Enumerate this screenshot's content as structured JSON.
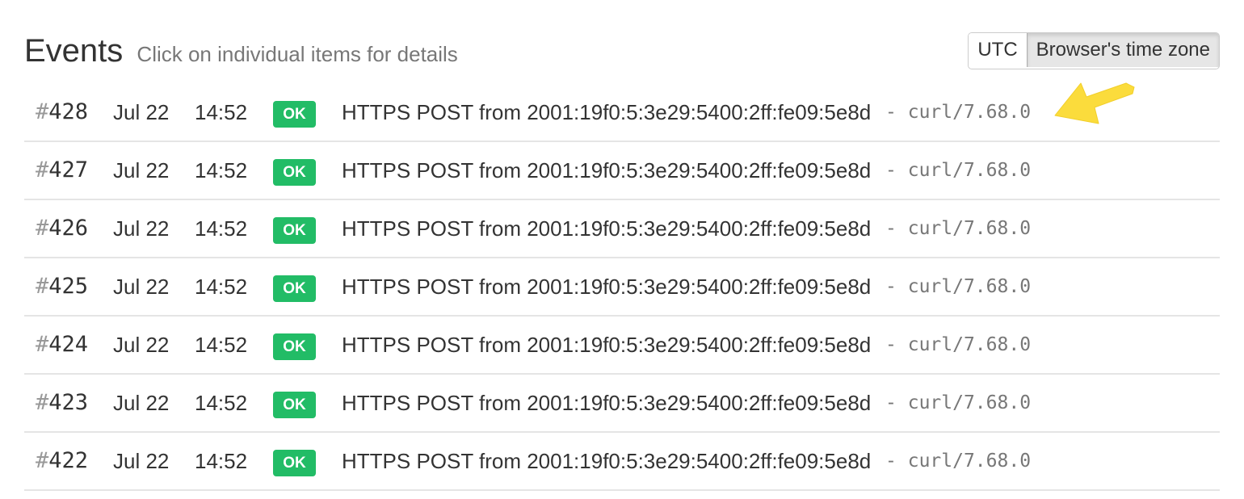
{
  "header": {
    "title": "Events",
    "subtitle": "Click on individual items for details",
    "timezone_options": [
      "UTC",
      "Browser's time zone"
    ],
    "timezone_selected": "Browser's time zone"
  },
  "status_color": "#22bc66",
  "annotation_arrow_color": "#fbdc3c",
  "events": [
    {
      "hash": "#",
      "number": "428",
      "date": "Jul 22",
      "time": "14:52",
      "status": "OK",
      "description": "HTTPS POST from 2001:19f0:5:3e29:5400:2ff:fe09:5e8d",
      "separator": "-",
      "user_agent": "curl/7.68.0"
    },
    {
      "hash": "#",
      "number": "427",
      "date": "Jul 22",
      "time": "14:52",
      "status": "OK",
      "description": "HTTPS POST from 2001:19f0:5:3e29:5400:2ff:fe09:5e8d",
      "separator": "-",
      "user_agent": "curl/7.68.0"
    },
    {
      "hash": "#",
      "number": "426",
      "date": "Jul 22",
      "time": "14:52",
      "status": "OK",
      "description": "HTTPS POST from 2001:19f0:5:3e29:5400:2ff:fe09:5e8d",
      "separator": "-",
      "user_agent": "curl/7.68.0"
    },
    {
      "hash": "#",
      "number": "425",
      "date": "Jul 22",
      "time": "14:52",
      "status": "OK",
      "description": "HTTPS POST from 2001:19f0:5:3e29:5400:2ff:fe09:5e8d",
      "separator": "-",
      "user_agent": "curl/7.68.0"
    },
    {
      "hash": "#",
      "number": "424",
      "date": "Jul 22",
      "time": "14:52",
      "status": "OK",
      "description": "HTTPS POST from 2001:19f0:5:3e29:5400:2ff:fe09:5e8d",
      "separator": "-",
      "user_agent": "curl/7.68.0"
    },
    {
      "hash": "#",
      "number": "423",
      "date": "Jul 22",
      "time": "14:52",
      "status": "OK",
      "description": "HTTPS POST from 2001:19f0:5:3e29:5400:2ff:fe09:5e8d",
      "separator": "-",
      "user_agent": "curl/7.68.0"
    },
    {
      "hash": "#",
      "number": "422",
      "date": "Jul 22",
      "time": "14:52",
      "status": "OK",
      "description": "HTTPS POST from 2001:19f0:5:3e29:5400:2ff:fe09:5e8d",
      "separator": "-",
      "user_agent": "curl/7.68.0"
    }
  ]
}
